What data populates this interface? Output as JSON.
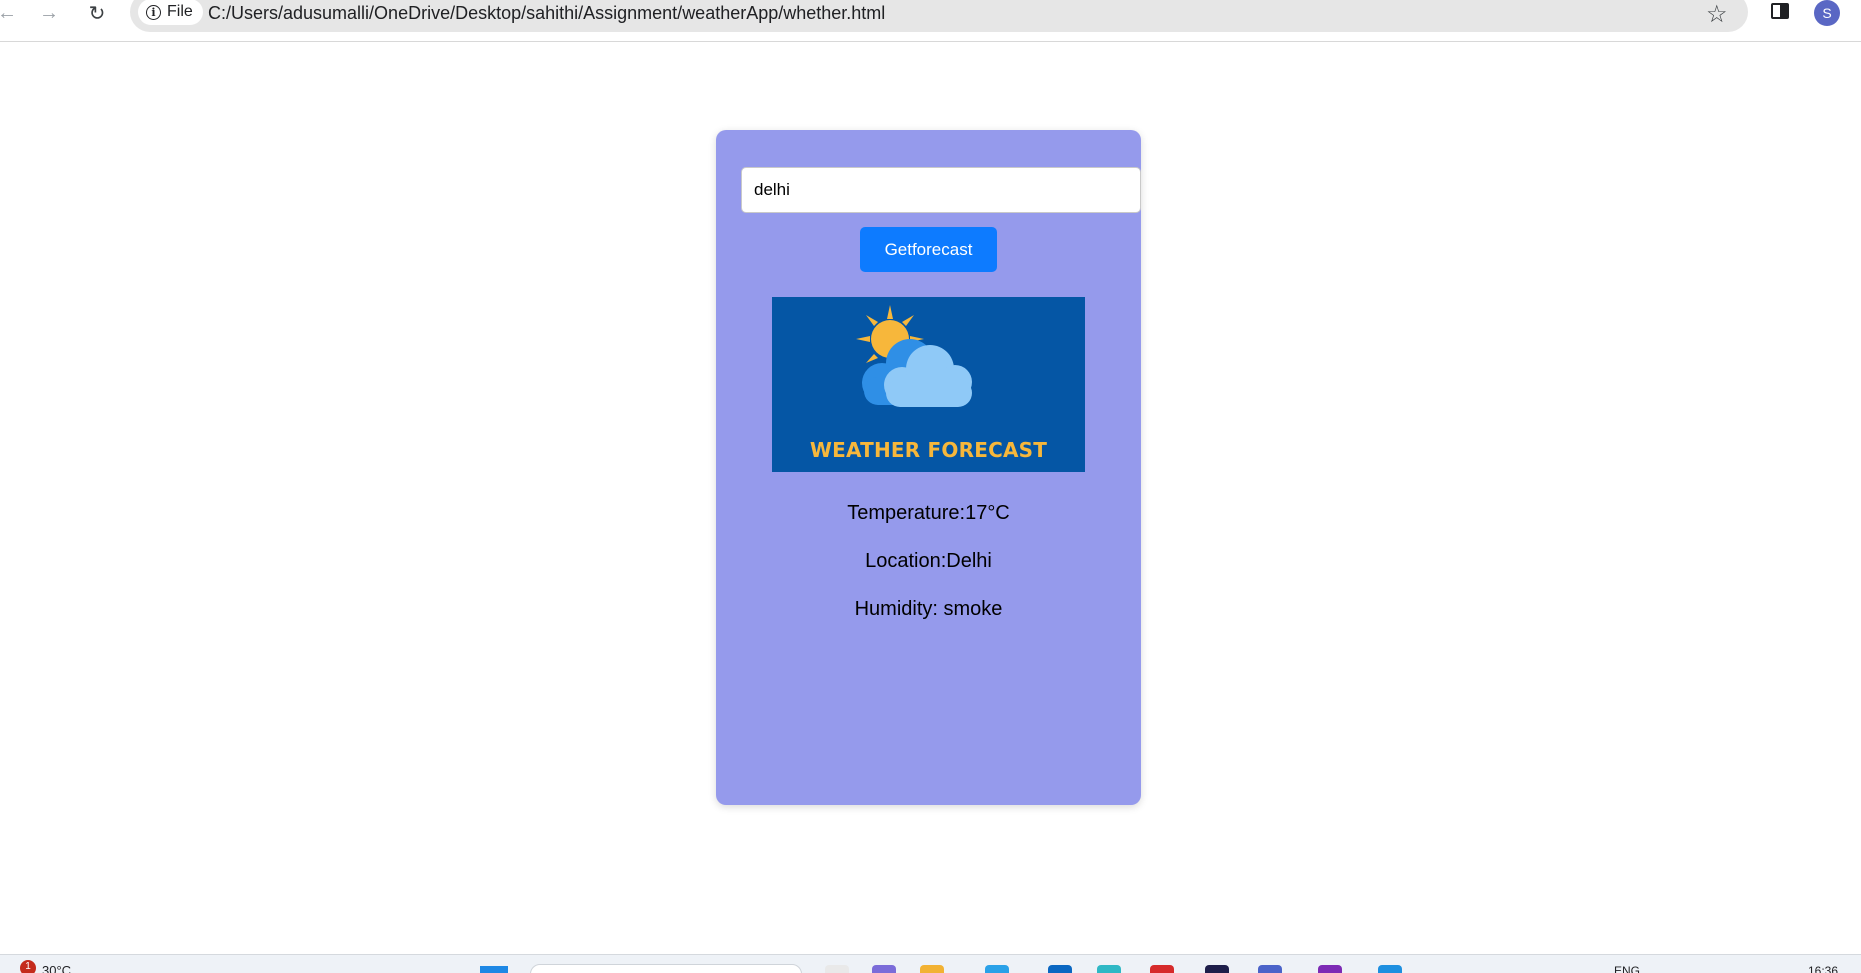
{
  "browser": {
    "chip_label": "File",
    "url": "C:/Users/adusumalli/OneDrive/Desktop/sahithi/Assignment/weatherApp/whether.html",
    "avatar_initial": "S"
  },
  "app": {
    "input_value": "delhi",
    "button_label": "Getforecast",
    "banner_text": "WEATHER FORECAST",
    "temperature_text": "Temperature:17°C",
    "location_text": "Location:Delhi",
    "humidity_text": "Humidity: smoke"
  },
  "taskbar": {
    "notification_count": "1",
    "weather_temp": "30°C",
    "language": "ENG",
    "time": "16:36"
  },
  "colors": {
    "card_background": "#959aec",
    "button_background": "#0d7bff",
    "banner_background": "#0556a5",
    "banner_text": "#f7b73b"
  }
}
